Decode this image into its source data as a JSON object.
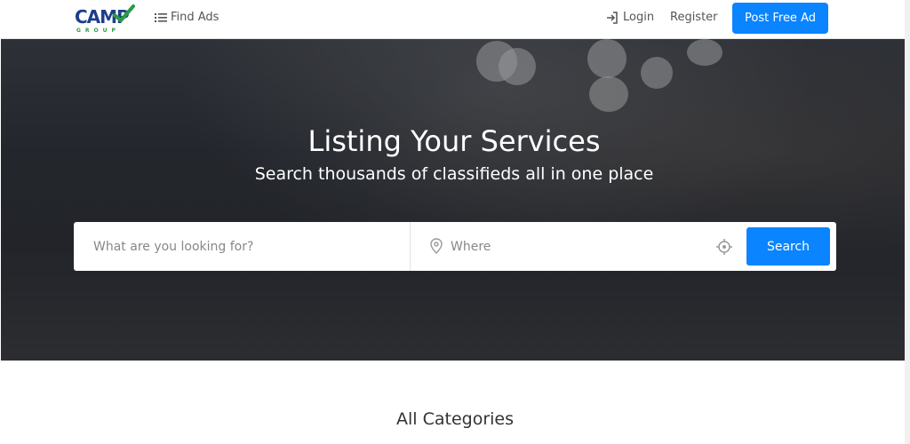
{
  "header": {
    "logo_text": "CAMP",
    "logo_sub": "GROUP",
    "find_ads_label": "Find Ads",
    "login_label": "Login",
    "register_label": "Register",
    "post_ad_label": "Post Free Ad"
  },
  "hero": {
    "title": "Listing Your Services",
    "subtitle": "Search thousands of classifieds all in one place",
    "search": {
      "what_placeholder": "What are you looking for?",
      "where_placeholder": "Where",
      "button_label": "Search"
    }
  },
  "categories": {
    "heading": "All Categories"
  },
  "colors": {
    "accent": "#0a84ff",
    "logo_blue": "#1d3f8a",
    "logo_green": "#2a9b43"
  }
}
